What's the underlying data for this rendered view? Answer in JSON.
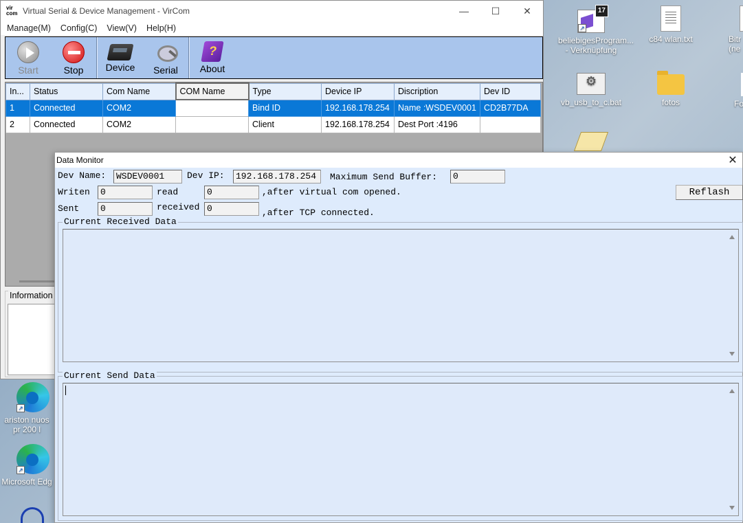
{
  "desktop": {
    "icons": [
      {
        "label": "beliebigesProgram... - Verknüpfung",
        "badge": "17"
      },
      {
        "label": "c84 wlan.txt"
      },
      {
        "label": "Bitr (ne"
      },
      {
        "label": "vb_usb_to_c.bat"
      },
      {
        "label": "fotos"
      },
      {
        "label": "Fo"
      },
      {
        "label": "ariston nuos pr 200 l"
      },
      {
        "label": "Microsoft Edg"
      }
    ]
  },
  "main_window": {
    "app_logo": "vir com",
    "title": "Virtual Serial & Device Management - VirCom",
    "controls": {
      "minimize": "—",
      "maximize": "☐",
      "close": "✕"
    },
    "menu": [
      "Manage(M)",
      "Config(C)",
      "View(V)",
      "Help(H)"
    ],
    "toolbar": [
      {
        "label": "Start",
        "icon": "start-icon",
        "enabled": false
      },
      {
        "label": "Stop",
        "icon": "stop-icon",
        "enabled": true
      },
      {
        "label": "Device",
        "icon": "device-icon",
        "enabled": true
      },
      {
        "label": "Serial",
        "icon": "serial-icon",
        "enabled": true
      },
      {
        "label": "About",
        "icon": "about-icon",
        "enabled": true
      }
    ],
    "table": {
      "columns": [
        "In...",
        "Status",
        "Com Name",
        "COM Name",
        "Type",
        "Device IP",
        "Discription",
        "Dev ID"
      ],
      "rows": [
        [
          "1",
          "Connected",
          "COM2",
          "",
          "Bind ID",
          "192.168.178.254",
          "Name :WSDEV0001",
          "CD2B77DA"
        ],
        [
          "2",
          "Connected",
          "COM2",
          "",
          "Client",
          "192.168.178.254",
          "Dest Port :4196",
          ""
        ]
      ]
    },
    "info_label": "Information"
  },
  "data_monitor": {
    "title": "Data Monitor",
    "close": "✕",
    "dev_name_label": "Dev Name:",
    "dev_name_value": "WSDEV0001",
    "dev_ip_label": "Dev IP:",
    "dev_ip_value": "192.168.178.254",
    "max_buffer_label": "Maximum Send Buffer:",
    "max_buffer_value": "0",
    "reflash_label": "Reflash",
    "writen_label": "Writen",
    "writen_value": "0",
    "read_label": "read",
    "read_value": "0",
    "after_vcom": ",after virtual com opened.",
    "sent_label": "Sent",
    "sent_value": "0",
    "received_label": "received",
    "received_value": "0",
    "after_tcp": ",after TCP connected.",
    "received_group": "Current Received Data",
    "send_group": "Current Send Data"
  }
}
